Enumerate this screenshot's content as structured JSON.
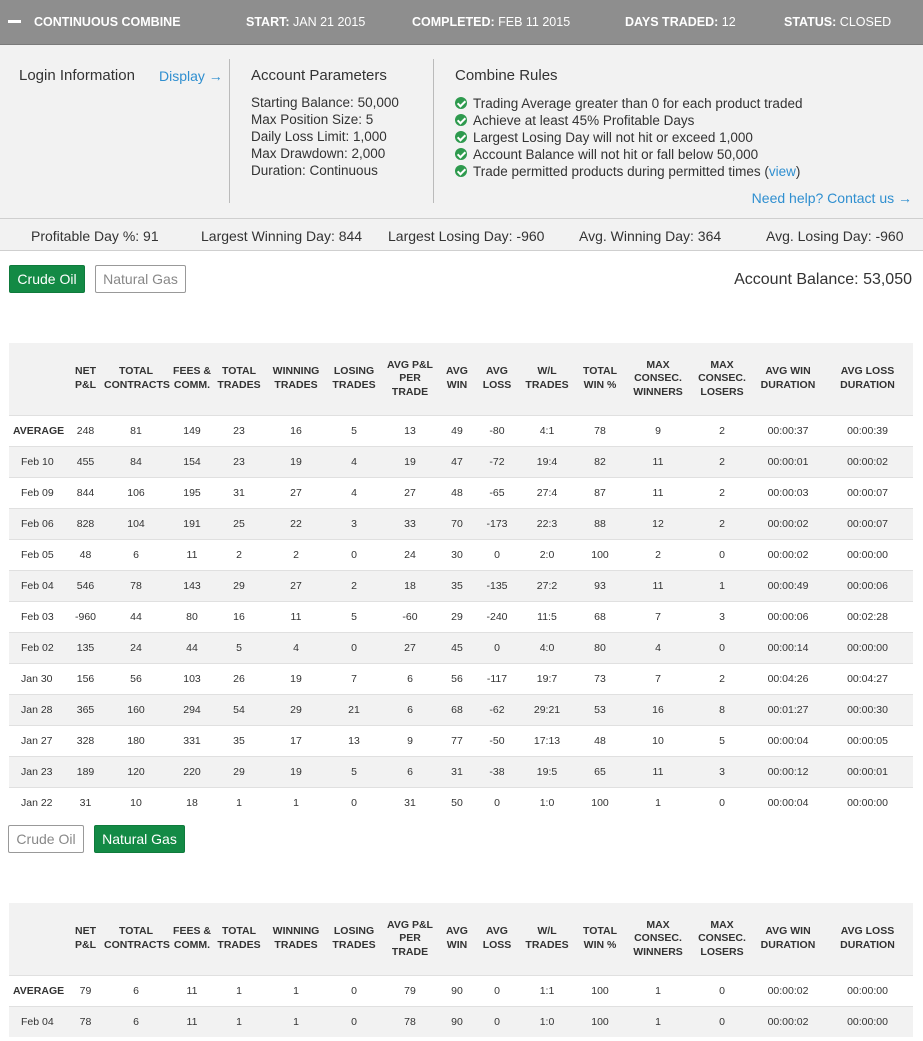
{
  "header": {
    "title": "CONTINUOUS COMBINE",
    "start_label": "START:",
    "start_value": "JAN 21 2015",
    "completed_label": "COMPLETED:",
    "completed_value": "FEB 11 2015",
    "days_label": "DAYS TRADED:",
    "days_value": "12",
    "status_label": "STATUS:",
    "status_value": "CLOSED"
  },
  "login": {
    "title": "Login Information",
    "display_link": "Display →"
  },
  "params": {
    "title": "Account Parameters",
    "rows": [
      "Starting Balance: 50,000",
      "Max Position Size: 5",
      "Daily Loss Limit: 1,000",
      "Max Drawdown: 2,000",
      "Duration: Continuous"
    ]
  },
  "rules": {
    "title": "Combine Rules",
    "items": [
      "Trading Average greater than 0 for each product traded",
      "Achieve at least 45% Profitable Days",
      "Largest Losing Day will not hit or exceed 1,000",
      "Account Balance will not hit or fall below 50,000",
      "Trade permitted products during permitted times ("
    ],
    "view_link": "view",
    "view_close": ")",
    "help_link": "Need help? Contact us →"
  },
  "stats": {
    "profitable": "Profitable Day %: 91",
    "largest_win": "Largest Winning Day: 844",
    "largest_loss": "Largest Losing Day: -960",
    "avg_win": "Avg. Winning Day: 364",
    "avg_loss": "Avg. Losing Day: -960"
  },
  "products": {
    "crude": "Crude Oil",
    "gas": "Natural Gas"
  },
  "balance": "Account Balance: 53,050",
  "table_headers": [
    "",
    "NET P&L",
    "TOTAL CONTRACTS",
    "FEES & COMM.",
    "TOTAL TRADES",
    "WINNING TRADES",
    "LOSING TRADES",
    "AVG P&L PER TRADE",
    "AVG WIN",
    "AVG LOSS",
    "W/L TRADES",
    "TOTAL WIN %",
    "MAX CONSEC. WINNERS",
    "MAX CONSEC. LOSERS",
    "AVG WIN DURATION",
    "AVG LOSS DURATION"
  ],
  "crude_table": [
    [
      "AVERAGE",
      "248",
      "81",
      "149",
      "23",
      "16",
      "5",
      "13",
      "49",
      "-80",
      "4:1",
      "78",
      "9",
      "2",
      "00:00:37",
      "00:00:39"
    ],
    [
      "Feb 10",
      "455",
      "84",
      "154",
      "23",
      "19",
      "4",
      "19",
      "47",
      "-72",
      "19:4",
      "82",
      "11",
      "2",
      "00:00:01",
      "00:00:02"
    ],
    [
      "Feb 09",
      "844",
      "106",
      "195",
      "31",
      "27",
      "4",
      "27",
      "48",
      "-65",
      "27:4",
      "87",
      "11",
      "2",
      "00:00:03",
      "00:00:07"
    ],
    [
      "Feb 06",
      "828",
      "104",
      "191",
      "25",
      "22",
      "3",
      "33",
      "70",
      "-173",
      "22:3",
      "88",
      "12",
      "2",
      "00:00:02",
      "00:00:07"
    ],
    [
      "Feb 05",
      "48",
      "6",
      "11",
      "2",
      "2",
      "0",
      "24",
      "30",
      "0",
      "2:0",
      "100",
      "2",
      "0",
      "00:00:02",
      "00:00:00"
    ],
    [
      "Feb 04",
      "546",
      "78",
      "143",
      "29",
      "27",
      "2",
      "18",
      "35",
      "-135",
      "27:2",
      "93",
      "11",
      "1",
      "00:00:49",
      "00:00:06"
    ],
    [
      "Feb 03",
      "-960",
      "44",
      "80",
      "16",
      "11",
      "5",
      "-60",
      "29",
      "-240",
      "11:5",
      "68",
      "7",
      "3",
      "00:00:06",
      "00:02:28"
    ],
    [
      "Feb 02",
      "135",
      "24",
      "44",
      "5",
      "4",
      "0",
      "27",
      "45",
      "0",
      "4:0",
      "80",
      "4",
      "0",
      "00:00:14",
      "00:00:00"
    ],
    [
      "Jan 30",
      "156",
      "56",
      "103",
      "26",
      "19",
      "7",
      "6",
      "56",
      "-117",
      "19:7",
      "73",
      "7",
      "2",
      "00:04:26",
      "00:04:27"
    ],
    [
      "Jan 28",
      "365",
      "160",
      "294",
      "54",
      "29",
      "21",
      "6",
      "68",
      "-62",
      "29:21",
      "53",
      "16",
      "8",
      "00:01:27",
      "00:00:30"
    ],
    [
      "Jan 27",
      "328",
      "180",
      "331",
      "35",
      "17",
      "13",
      "9",
      "77",
      "-50",
      "17:13",
      "48",
      "10",
      "5",
      "00:00:04",
      "00:00:05"
    ],
    [
      "Jan 23",
      "189",
      "120",
      "220",
      "29",
      "19",
      "5",
      "6",
      "31",
      "-38",
      "19:5",
      "65",
      "11",
      "3",
      "00:00:12",
      "00:00:01"
    ],
    [
      "Jan 22",
      "31",
      "10",
      "18",
      "1",
      "1",
      "0",
      "31",
      "50",
      "0",
      "1:0",
      "100",
      "1",
      "0",
      "00:00:04",
      "00:00:00"
    ]
  ],
  "gas_table": [
    [
      "AVERAGE",
      "79",
      "6",
      "11",
      "1",
      "1",
      "0",
      "79",
      "90",
      "0",
      "1:1",
      "100",
      "1",
      "0",
      "00:00:02",
      "00:00:00"
    ],
    [
      "Feb 04",
      "78",
      "6",
      "11",
      "1",
      "1",
      "0",
      "78",
      "90",
      "0",
      "1:0",
      "100",
      "1",
      "0",
      "00:00:02",
      "00:00:00"
    ]
  ],
  "colors": {
    "active_green": "#138a45",
    "link_blue": "#2f8fd0",
    "check_green": "#2e9a4e",
    "header_gray": "#8e8e8e"
  },
  "icons": {
    "collapse": "minus-icon",
    "rule_check": "check-circle-icon"
  }
}
